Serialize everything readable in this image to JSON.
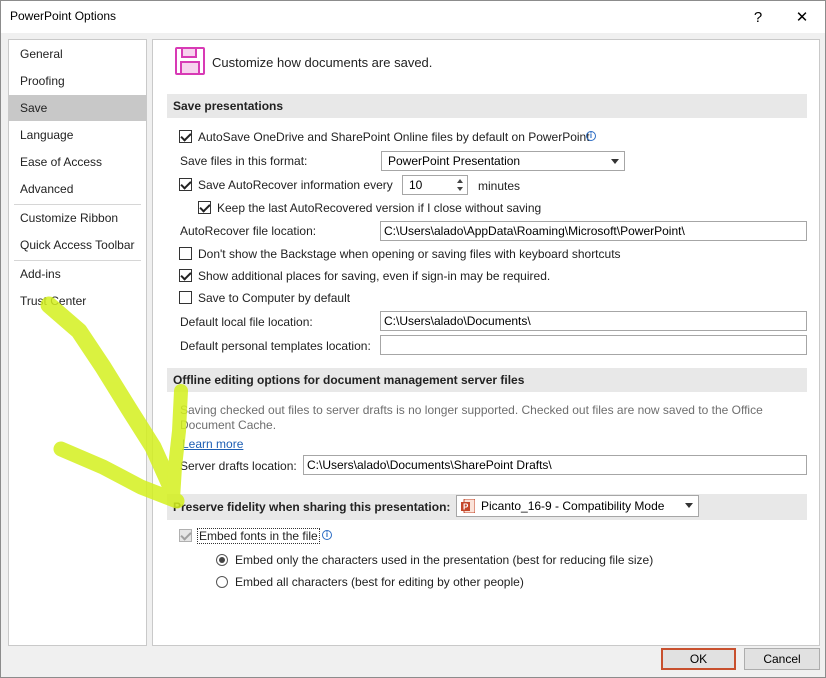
{
  "window": {
    "title": "PowerPoint Options",
    "help_glyph": "?",
    "close_glyph": "✕"
  },
  "sidebar": {
    "items": [
      {
        "label": "General"
      },
      {
        "label": "Proofing"
      },
      {
        "label": "Save",
        "selected": true
      },
      {
        "label": "Language"
      },
      {
        "label": "Ease of Access"
      },
      {
        "label": "Advanced"
      },
      {
        "label": "Customize Ribbon"
      },
      {
        "label": "Quick Access Toolbar"
      },
      {
        "label": "Add-ins"
      },
      {
        "label": "Trust Center"
      }
    ]
  },
  "header": {
    "icon": "save-floppy-icon",
    "text": "Customize how documents are saved."
  },
  "save_presentations": {
    "heading": "Save presentations",
    "autosave_label": "AutoSave OneDrive and SharePoint Online files by default on PowerPoint",
    "autosave_checked": true,
    "format_label": "Save files in this format:",
    "format_value": "PowerPoint Presentation",
    "autorecover_label": "Save AutoRecover information every",
    "autorecover_checked": true,
    "autorecover_minutes": "10",
    "minutes_label": "minutes",
    "keep_last_label": "Keep the last AutoRecovered version if I close without saving",
    "keep_last_checked": true,
    "autorecover_location_label": "AutoRecover file location:",
    "autorecover_location_value": "C:\\Users\\alado\\AppData\\Roaming\\Microsoft\\PowerPoint\\",
    "backstage_label": "Don't show the Backstage when opening or saving files with keyboard shortcuts",
    "backstage_checked": false,
    "additional_places_label": "Show additional places for saving, even if sign-in may be required.",
    "additional_places_checked": true,
    "save_to_computer_label": "Save to Computer by default",
    "save_to_computer_checked": false,
    "default_local_label": "Default local file location:",
    "default_local_value": "C:\\Users\\alado\\Documents\\",
    "templates_label": "Default personal templates location:",
    "templates_value": ""
  },
  "offline": {
    "heading": "Offline editing options for document management server files",
    "info_line1": "Saving checked out files to server drafts is no longer supported. Checked out files are now saved to the Office",
    "info_line2": "Document Cache.",
    "learn_more": "Learn more",
    "drafts_label": "Server drafts location:",
    "drafts_value": "C:\\Users\\alado\\Documents\\SharePoint Drafts\\"
  },
  "fidelity": {
    "heading": "Preserve fidelity when sharing this presentation:",
    "file_value": "Picanto_16-9  -  Compatibility Mode",
    "file_icon": "powerpoint-file-icon",
    "embed_label": "Embed fonts in the file",
    "embed_checked": true,
    "embed_only_label": "Embed only the characters used in the presentation (best for reducing file size)",
    "embed_only_selected": true,
    "embed_all_label": "Embed all characters (best for editing by other people)",
    "embed_all_selected": false
  },
  "footer": {
    "ok_label": "OK",
    "cancel_label": "Cancel"
  },
  "colors": {
    "accent_ok_border": "#c8502e",
    "arrow_annotation": "#d4f01e",
    "link": "#1e5fb4",
    "save_icon": "#d83ab5"
  }
}
